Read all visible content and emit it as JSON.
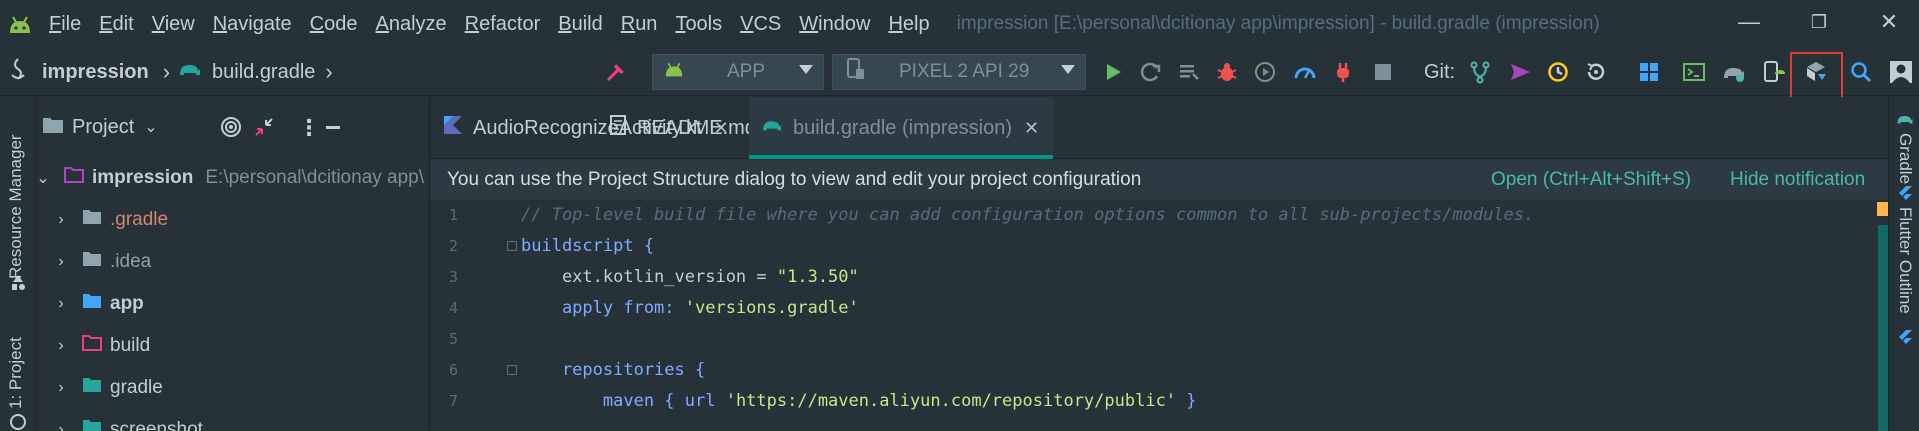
{
  "menubar": {
    "app_icon": "android-icon",
    "items": [
      "File",
      "Edit",
      "View",
      "Navigate",
      "Code",
      "Analyze",
      "Refactor",
      "Build",
      "Run",
      "Tools",
      "VCS",
      "Window",
      "Help"
    ],
    "window_title": "impression [E:\\personal\\dcitionay app\\impression] - build.gradle (impression)",
    "controls": {
      "minimize": "—",
      "restore": "❐",
      "close": "✕"
    }
  },
  "toolbar": {
    "breadcrumb": [
      {
        "label": "impression",
        "icon": "project-icon"
      },
      {
        "label": "build.gradle",
        "icon": "gradle-elephant-icon"
      }
    ],
    "run_config": {
      "label": "APP",
      "icon": "android-icon"
    },
    "device": {
      "label": "PIXEL 2 API 29",
      "icon": "device-icon"
    },
    "git_label": "Git:",
    "icons": [
      "hammer-icon",
      "run-icon",
      "apply-changes-icon",
      "coverage-icon",
      "debug-icon",
      "profile-icon",
      "profiler-icon",
      "attach-debugger-icon",
      "stop-icon",
      "git-branch-icon",
      "git-push-icon",
      "git-history-icon",
      "git-rollback-icon",
      "layout-icon",
      "terminal-icon",
      "gradle-sync-icon",
      "avd-manager-icon",
      "sdk-manager-icon",
      "search-icon",
      "avatar-icon"
    ]
  },
  "left_stripe": {
    "resource_manager": "Resource Manager",
    "project": "1: Project"
  },
  "project_panel": {
    "title": "Project",
    "tree": [
      {
        "name": "impression",
        "path": "E:\\personal\\dcitionay app\\",
        "expanded": true,
        "color": "#c3ced3",
        "bold": true
      },
      {
        "name": ".gradle",
        "color": "#d08770"
      },
      {
        "name": ".idea",
        "color": "#8fa1a9"
      },
      {
        "name": "app",
        "color": "#c3ced3",
        "bold": true
      },
      {
        "name": "build",
        "color": "#c3ced3"
      },
      {
        "name": "gradle",
        "color": "#c3ced3"
      },
      {
        "name": "screenshot",
        "color": "#c3ced3"
      }
    ]
  },
  "tabs": [
    {
      "label": "AudioRecognizeActivity.kt",
      "icon": "kotlin-icon",
      "active": false
    },
    {
      "label": "README.md",
      "icon": "markdown-icon",
      "active": false
    },
    {
      "label": "build.gradle (impression)",
      "icon": "gradle-elephant-icon",
      "active": true
    }
  ],
  "notification": {
    "text": "You can use the Project Structure dialog to view and edit your project configuration",
    "open_link": "Open (Ctrl+Alt+Shift+S)",
    "hide_link": "Hide notification"
  },
  "editor": {
    "line_numbers": [
      "1",
      "2",
      "3",
      "4",
      "5",
      "6",
      "7"
    ],
    "lines": [
      [
        {
          "t": "// Top-level build file where you can add configuration options common to all sub-projects/modules.",
          "c": "comment"
        }
      ],
      [
        {
          "t": "buildscript {",
          "c": "kw"
        }
      ],
      [
        {
          "t": "    ext.kotlin_version = ",
          "c": "plain"
        },
        {
          "t": "\"1.3.50\"",
          "c": "str"
        }
      ],
      [
        {
          "t": "    apply from: ",
          "c": "kw"
        },
        {
          "t": "'versions.gradle'",
          "c": "str"
        }
      ],
      [
        {
          "t": "",
          "c": "plain"
        }
      ],
      [
        {
          "t": "    repositories {",
          "c": "kw"
        }
      ],
      [
        {
          "t": "        maven { url ",
          "c": "kw"
        },
        {
          "t": "'https://maven.aliyun.com/repository/public'",
          "c": "str"
        },
        {
          "t": " }",
          "c": "kw"
        }
      ]
    ]
  },
  "right_stripe": {
    "gradle": "Gradle",
    "flutter_outline": "Flutter Outline"
  }
}
